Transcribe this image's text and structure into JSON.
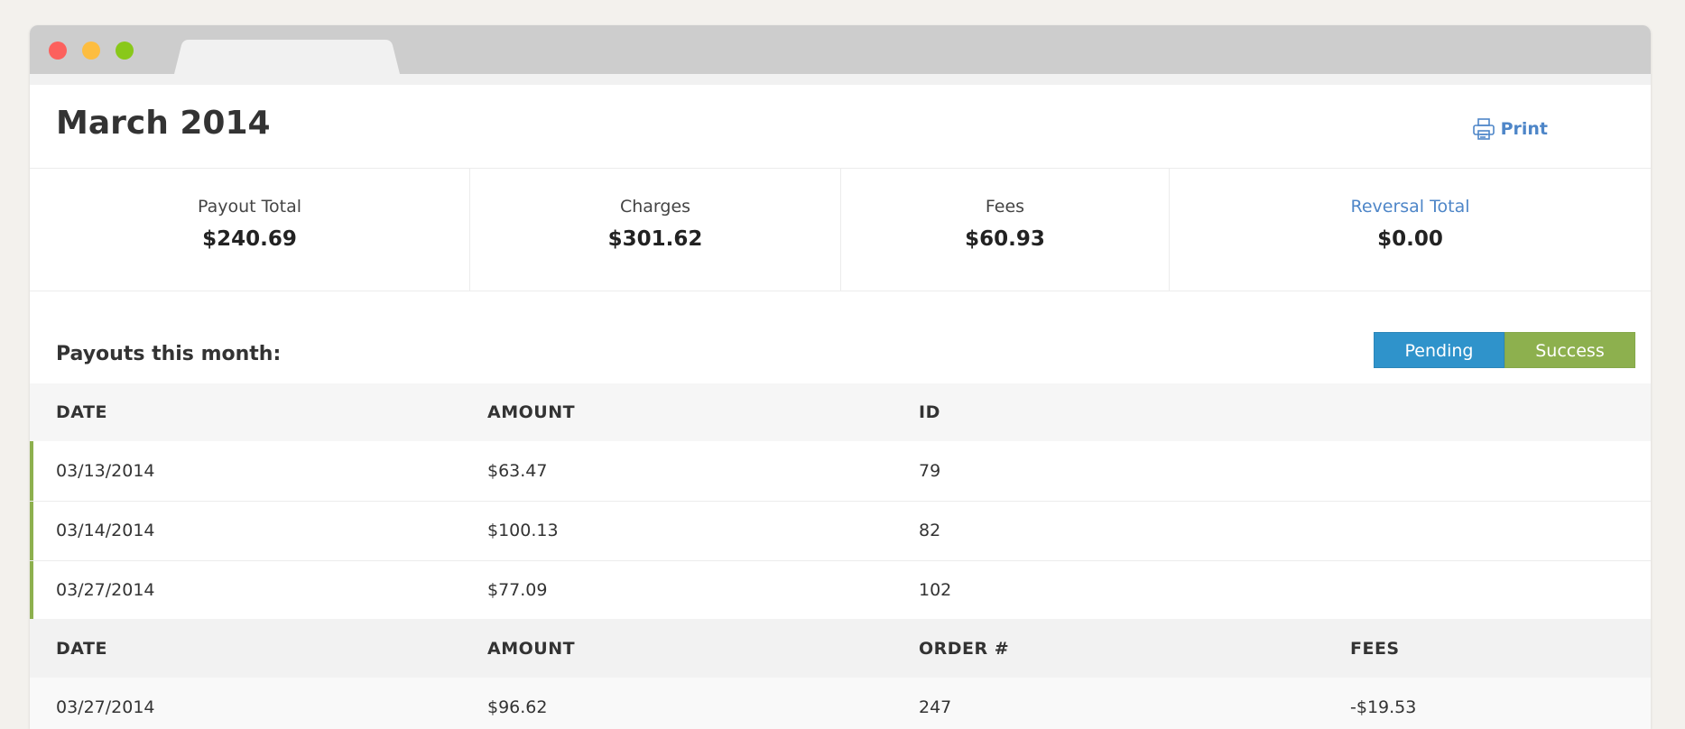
{
  "header": {
    "title": "March 2014",
    "print_label": "Print"
  },
  "summary": [
    {
      "label": "Payout Total",
      "value": "$240.69"
    },
    {
      "label": "Charges",
      "value": "$301.62"
    },
    {
      "label": "Fees",
      "value": "$60.93"
    },
    {
      "label": "Reversal Total",
      "value": "$0.00"
    }
  ],
  "payouts": {
    "title": "Payouts this month:",
    "filters": {
      "pending": "Pending",
      "success": "Success"
    },
    "columns": [
      "DATE",
      "AMOUNT",
      "ID"
    ],
    "rows": [
      {
        "date": "03/13/2014",
        "amount": "$63.47",
        "id": "79"
      },
      {
        "date": "03/14/2014",
        "amount": "$100.13",
        "id": "82"
      },
      {
        "date": "03/27/2014",
        "amount": "$77.09",
        "id": "102"
      }
    ]
  },
  "details": {
    "columns": [
      "DATE",
      "AMOUNT",
      "ORDER #",
      "FEES"
    ],
    "rows": [
      {
        "date": "03/27/2014",
        "amount": "$96.62",
        "order": "247",
        "fees": "-$19.53"
      }
    ]
  },
  "colors": {
    "accent_link": "#4e86c8",
    "pending": "#2f93cb",
    "success": "#8db04e",
    "close_dot": "#fc615d",
    "minimize_dot": "#fdbd40",
    "zoom_dot": "#89c81a"
  },
  "icons": {
    "print": "printer-icon"
  }
}
